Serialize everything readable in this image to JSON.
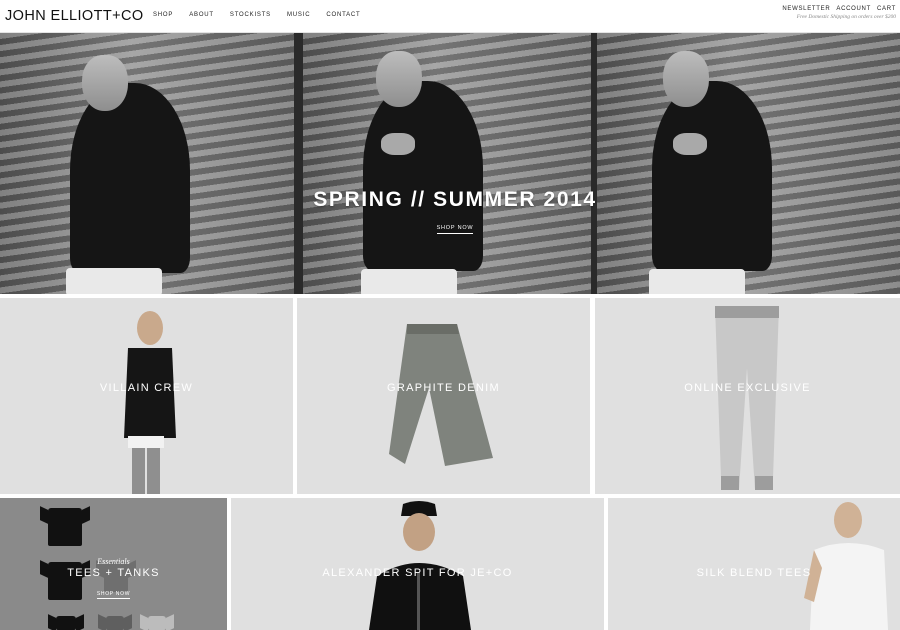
{
  "header": {
    "logo": "JOHN ELLIOTT+CO",
    "nav": [
      "SHOP",
      "ABOUT",
      "STOCKISTS",
      "MUSIC",
      "CONTACT"
    ],
    "util_links": [
      "NEWSLETTER",
      "ACCOUNT",
      "CART"
    ],
    "shipping_note": "Free Domestic Shipping on orders over $200"
  },
  "hero": {
    "title": "SPRING // SUMMER 2014",
    "cta": "SHOP NOW"
  },
  "tiles": [
    {
      "label": "VILLAIN CREW"
    },
    {
      "label": "GRAPHITE DENIM"
    },
    {
      "label": "ONLINE EXCLUSIVE"
    },
    {
      "label": "TEES + TANKS",
      "script": "Essentials",
      "cta": "SHOP NOW"
    },
    {
      "label": "ALEXANDER SPIT FOR JE+CO"
    },
    {
      "label": "SILK BLEND TEES"
    }
  ],
  "colors": {
    "tile_bg": "#e0e0e0",
    "tees_bg": "#8a8a8a",
    "header_bg": "#ffffff"
  }
}
